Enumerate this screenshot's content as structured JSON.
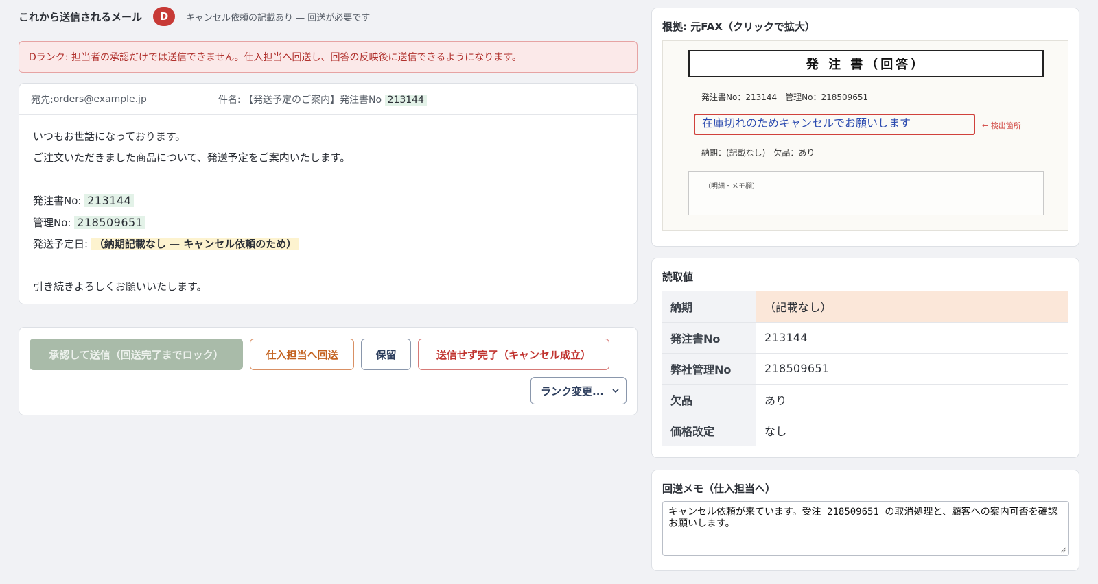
{
  "header": {
    "title": "これから送信されるメール",
    "rank": "D",
    "note": "キャンセル依頼の記載あり — 回送が必要です"
  },
  "alert": {
    "text": "Dランク: 担当者の承認だけでは送信できません。仕入担当へ回送し、回答の反映後に送信できるようになります。"
  },
  "mail": {
    "to_label": "宛先: ",
    "to_value": "orders@example.jp",
    "subject_label": "件名: ",
    "subject_prefix": "【発送予定のご案内】発注書No",
    "subject_number": "213144",
    "greeting1": "いつもお世話になっております。",
    "greeting2": "ご注文いただきました商品について、発送予定をご案内いたします。",
    "po_label": "発注書No:",
    "po_value": "213144",
    "mgmt_label": "管理No:",
    "mgmt_value": "218509651",
    "ship_label": "発送予定日:",
    "ship_value": "（納期記載なし — キャンセル依頼のため）",
    "closing": "引き続きよろしくお願いいたします。"
  },
  "actions": {
    "approve": "承認して送信（回送完了までロック）",
    "return": "仕入担当へ回送",
    "hold": "保留",
    "cancel_done": "送信せず完了（キャンセル成立）",
    "rank_change": "ランク変更..."
  },
  "fax": {
    "panel_title": "根拠: 元FAX（クリックで拡大）",
    "doc_title": "発 注 書（回答）",
    "ids": "発注書No：213144　管理No：218509651",
    "detected_text": "在庫切れのためキャンセルでお願いします",
    "detected_tag": "← 検出箇所",
    "meta": "納期：(記載なし)　欠品：あり",
    "memo_label": "（明細・メモ欄）"
  },
  "readings": {
    "panel_title": "読取値",
    "rows": [
      {
        "label": "納期",
        "value": "（記載なし）"
      },
      {
        "label": "発注書No",
        "value": "213144"
      },
      {
        "label": "弊社管理No",
        "value": "218509651"
      },
      {
        "label": "欠品",
        "value": "あり"
      },
      {
        "label": "価格改定",
        "value": "なし"
      }
    ]
  },
  "return_memo": {
    "panel_title": "回送メモ（仕入担当へ）",
    "text": "キャンセル依頼が来ています。受注 218509651 の取消処理と、顧客への案内可否を確認お願いします。"
  },
  "colors": {
    "danger": "#c73a36",
    "alert_bg": "#fbe9e9",
    "approve_disabled": "#a9bba9",
    "return_orange": "#c3611e",
    "highlight_green": "#e3f2e8",
    "highlight_yellow": "#fdf3cf",
    "warn_row": "#fbe7d9"
  }
}
